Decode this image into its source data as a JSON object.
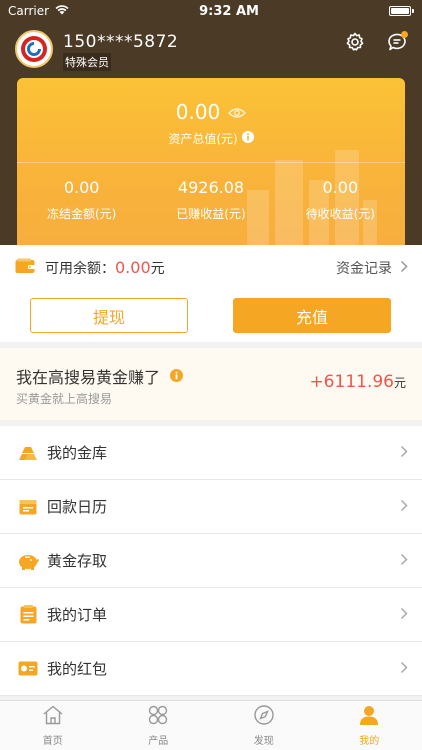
{
  "status_bar": {
    "carrier": "Carrier",
    "time": "9:32 AM"
  },
  "user": {
    "phone": "150****5872",
    "level": "特殊会员"
  },
  "assets": {
    "total_value": "0.00",
    "total_label": "资产总值(元)",
    "stats": [
      {
        "value": "0.00",
        "label": "冻结金额(元)"
      },
      {
        "value": "4926.08",
        "label": "已赚收益(元)"
      },
      {
        "value": "0.00",
        "label": "待收收益(元)"
      }
    ]
  },
  "balance": {
    "label": "可用余额：",
    "amount": "0.00",
    "unit": "元",
    "record_link": "资金记录",
    "withdraw": "提现",
    "recharge": "充值"
  },
  "earnings": {
    "title": "我在高搜易黄金赚了",
    "subtitle": "买黄金就上高搜易",
    "amount": "+6111.96",
    "unit": "元"
  },
  "menu": [
    {
      "label": "我的金库",
      "icon": "gold-bars-icon"
    },
    {
      "label": "回款日历",
      "icon": "calendar-icon"
    },
    {
      "label": "黄金存取",
      "icon": "piggy-bank-icon"
    },
    {
      "label": "我的订单",
      "icon": "order-list-icon"
    },
    {
      "label": "我的红包",
      "icon": "red-packet-icon"
    }
  ],
  "tabs": [
    {
      "label": "首页",
      "icon": "home-icon"
    },
    {
      "label": "产品",
      "icon": "grid-icon"
    },
    {
      "label": "发现",
      "icon": "compass-icon"
    },
    {
      "label": "我的",
      "icon": "person-icon"
    }
  ],
  "colors": {
    "accent": "#f5a623",
    "header_bg": "#4b3a26",
    "money_red": "#f0564d"
  }
}
